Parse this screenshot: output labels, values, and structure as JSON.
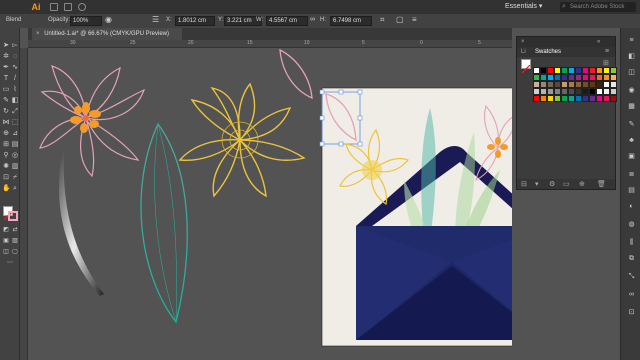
{
  "app": {
    "logo_text": "Ai",
    "brand_color": "#ff9a00"
  },
  "menubar": {
    "workspace_label": "Essentials",
    "search_placeholder": "Search Adobe Stock"
  },
  "controlbar": {
    "blend_label": "Blend",
    "opacity_label": "Opacity:",
    "opacity_value": "100%",
    "x_label": "X:",
    "x_value": "1.8012 cm",
    "y_label": "Y:",
    "y_value": "3.221 cm",
    "w_label": "W:",
    "w_value": "4.5567 cm",
    "h_label": "H:",
    "h_value": "6.7498 cm"
  },
  "document": {
    "tab_title": "Untitled-1.ai* @ 66.67% (CMYK/GPU Preview)",
    "close_glyph": "×"
  },
  "ruler_ticks": [
    "30",
    "25",
    "20",
    "15",
    "10",
    "5",
    "0",
    "5"
  ],
  "swatches_panel": {
    "title": "Swatches",
    "other_tab": "Li"
  },
  "icons": {
    "toolbar": [
      "selection-icon",
      "direct-selection-icon",
      "magic-wand-icon",
      "lasso-icon",
      "pen-icon",
      "curvature-icon",
      "type-icon",
      "line-icon",
      "rectangle-icon",
      "paintbrush-icon",
      "pencil-icon",
      "eraser-icon",
      "rotate-icon",
      "scale-icon",
      "width-icon",
      "free-transform-icon",
      "shape-builder-icon",
      "perspective-icon",
      "mesh-icon",
      "gradient-icon",
      "eyedropper-icon",
      "blend-icon",
      "symbol-sprayer-icon",
      "graph-icon",
      "artboard-icon",
      "slice-icon",
      "hand-icon",
      "zoom-icon"
    ],
    "dock": [
      "properties-icon",
      "layers-icon",
      "libraries-icon",
      "color-icon",
      "swatches-icon",
      "brushes-icon",
      "symbols-icon",
      "graphic-styles-icon",
      "stroke-icon",
      "gradient-panel-icon",
      "transparency-icon",
      "appearance-icon",
      "align-icon",
      "pathfinder-icon",
      "transform-icon",
      "links-icon",
      "artboards-icon"
    ]
  }
}
